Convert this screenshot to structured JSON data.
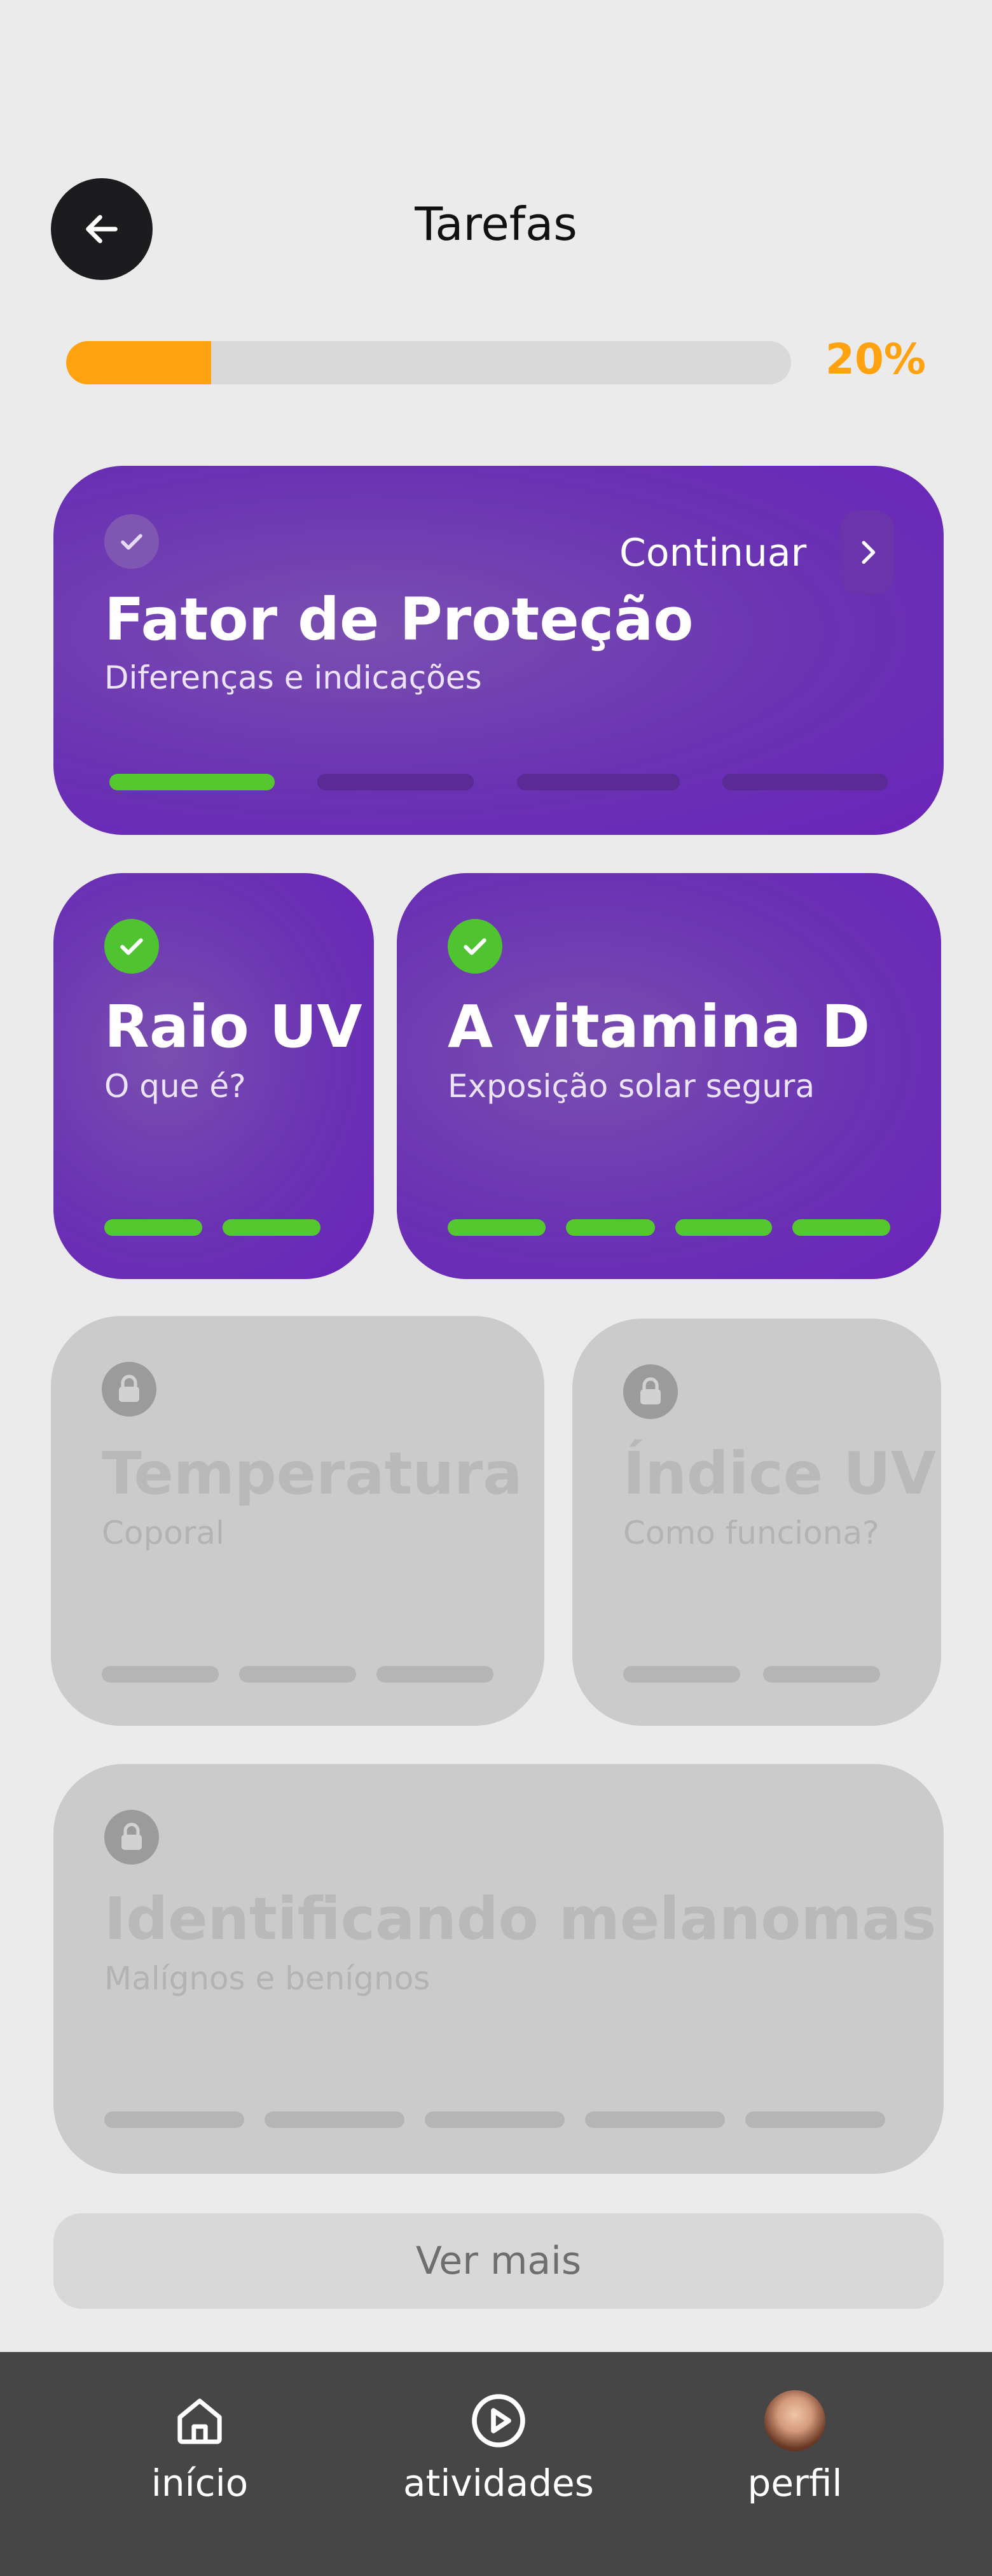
{
  "header": {
    "title": "Tarefas",
    "back_icon": "arrow-left-icon"
  },
  "progress": {
    "value": 0.2,
    "label": "20%",
    "color": "#ffa20f"
  },
  "cards": [
    {
      "title": "Fator de Proteção",
      "subtitle": "Diferenças e indicações",
      "status": "current",
      "segments_done": 1,
      "segments_total": 4,
      "action_label": "Continuar"
    },
    {
      "title": "Raio UV",
      "subtitle": "O que é?",
      "status": "done",
      "segments_done": 2,
      "segments_total": 2
    },
    {
      "title": "A vitamina D",
      "subtitle": "Exposição solar segura",
      "status": "done",
      "segments_done": 4,
      "segments_total": 4
    },
    {
      "title": "Temperatura",
      "subtitle": "Coporal",
      "status": "locked",
      "segments_done": 0,
      "segments_total": 3
    },
    {
      "title": "Índice UV",
      "subtitle": "Como funciona?",
      "status": "locked",
      "segments_done": 0,
      "segments_total": 2
    },
    {
      "title": "Identificando melanomas",
      "subtitle": "Malígnos e benígnos",
      "status": "locked",
      "segments_done": 0,
      "segments_total": 5
    }
  ],
  "more_button": {
    "label": "Ver mais"
  },
  "nav": {
    "items": [
      {
        "label": "início",
        "icon": "home-icon"
      },
      {
        "label": "atividades",
        "icon": "play-circle-icon"
      },
      {
        "label": "perfil",
        "icon": "avatar"
      }
    ]
  },
  "colors": {
    "accent_purple": "#6a2ab8",
    "progress_orange": "#ffa20f",
    "complete_green": "#56c82f",
    "locked_grey": "#cbcbcb"
  }
}
